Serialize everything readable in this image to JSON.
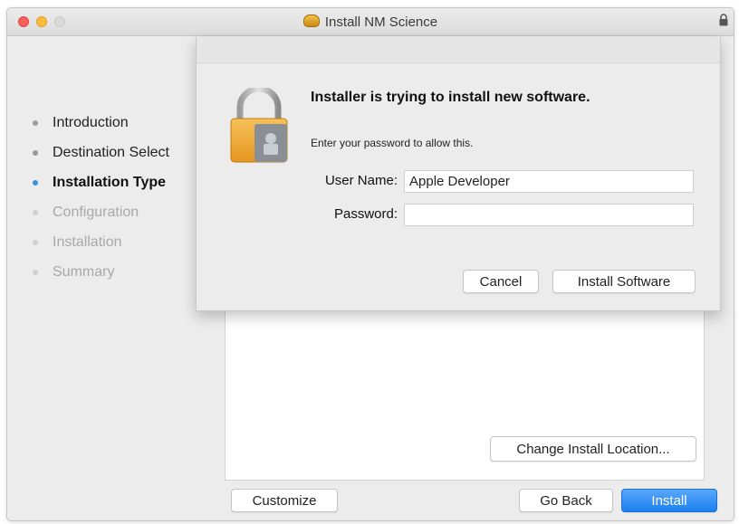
{
  "window": {
    "title": "Install NM Science"
  },
  "sidebar": {
    "steps": [
      {
        "label": "Introduction",
        "state": "done"
      },
      {
        "label": "Destination Select",
        "state": "done"
      },
      {
        "label": "Installation Type",
        "state": "current"
      },
      {
        "label": "Configuration",
        "state": "future"
      },
      {
        "label": "Installation",
        "state": "future"
      },
      {
        "label": "Summary",
        "state": "future"
      }
    ]
  },
  "content": {
    "change_location_label": "Change Install Location..."
  },
  "footer": {
    "customize_label": "Customize",
    "go_back_label": "Go Back",
    "install_label": "Install"
  },
  "auth_dialog": {
    "title": "Installer is trying to install new software.",
    "subtitle": "Enter your password to allow this.",
    "username_label": "User Name:",
    "username_value": "Apple Developer",
    "password_label": "Password:",
    "password_value": "",
    "cancel_label": "Cancel",
    "install_software_label": "Install Software",
    "icon": "lock-icon"
  },
  "colors": {
    "accent": "#1c7ff0",
    "current_step_dot": "#3a8fe0",
    "close": "#fc605c",
    "minimize": "#fdbc40"
  }
}
